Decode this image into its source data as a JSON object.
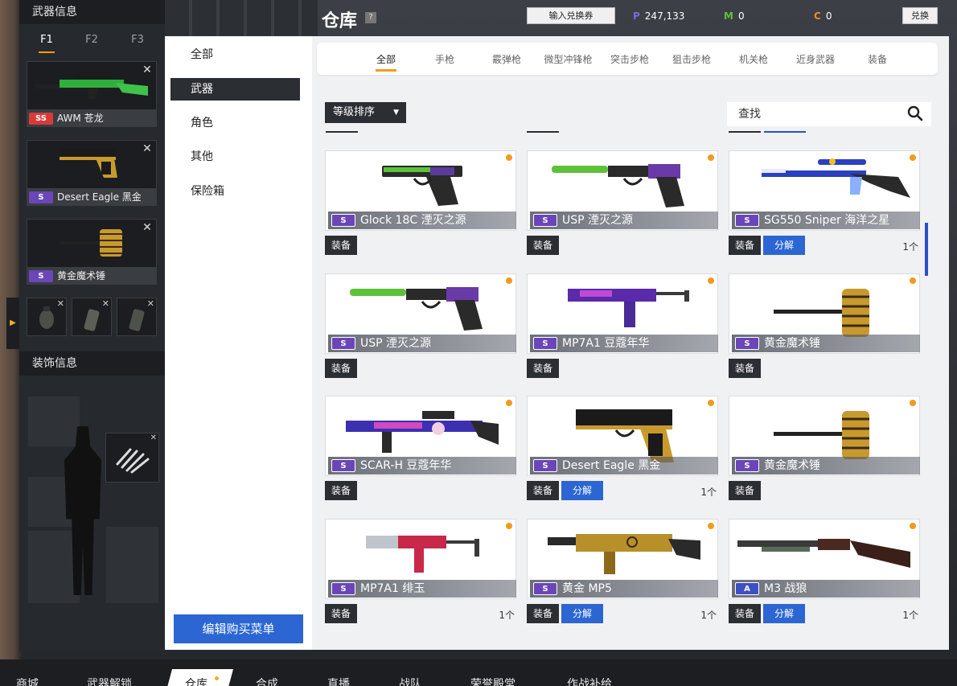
{
  "window": {
    "title": "仓库",
    "help": "?"
  },
  "header": {
    "redeem_button": "输入兑换券",
    "exchange_button": "兑换",
    "currencies": [
      {
        "letter": "P",
        "value": "247,133",
        "color": "#7a6ad8"
      },
      {
        "letter": "M",
        "value": "0",
        "color": "#5fbf3a"
      },
      {
        "letter": "C",
        "value": "0",
        "color": "#f08a24"
      }
    ]
  },
  "left_panel": {
    "weapon_info_title": "武器信息",
    "f_tabs": [
      "F1",
      "F2",
      "F3"
    ],
    "active_f_tab": "F1",
    "equipped": [
      {
        "grade": "SS",
        "name": "AWM 苍龙",
        "close": "✕"
      },
      {
        "grade": "S",
        "name": "Desert Eagle 黑金",
        "close": "✕"
      },
      {
        "grade": "S",
        "name": "黄金魔术锤",
        "close": "✕"
      }
    ],
    "grenade_close": "✕",
    "decoration_info_title": "装饰信息",
    "side_arrow": "▶"
  },
  "categories": [
    {
      "label": "全部",
      "active": false
    },
    {
      "label": "武器",
      "active": true
    },
    {
      "label": "角色",
      "active": false
    },
    {
      "label": "其他",
      "active": false
    },
    {
      "label": "保险箱",
      "active": false
    }
  ],
  "edit_menu_button": "编辑购买菜单",
  "type_tabs": [
    {
      "label": "全部",
      "active": true
    },
    {
      "label": "手枪",
      "active": false
    },
    {
      "label": "霰弹枪",
      "active": false
    },
    {
      "label": "微型冲锋枪",
      "active": false
    },
    {
      "label": "突击步枪",
      "active": false
    },
    {
      "label": "狙击步枪",
      "active": false
    },
    {
      "label": "机关枪",
      "active": false
    },
    {
      "label": "近身武器",
      "active": false
    },
    {
      "label": "装备",
      "active": false
    }
  ],
  "sort": {
    "label": "等级排序",
    "caret": "▼"
  },
  "search": {
    "placeholder": "查找"
  },
  "item_buttons": {
    "equip": "装备",
    "decompose": "分解"
  },
  "items": [
    {
      "name": "Glock 18C 湮灭之源",
      "grade": "S",
      "decomposable": false,
      "count": "",
      "gun": "pistol-green"
    },
    {
      "name": "USP 湮灭之源",
      "grade": "S",
      "decomposable": false,
      "count": "",
      "gun": "usp-green"
    },
    {
      "name": "SG550 Sniper 海洋之星",
      "grade": "S",
      "decomposable": true,
      "count": "1个",
      "gun": "sniper-blue"
    },
    {
      "name": "USP 湮灭之源",
      "grade": "S",
      "decomposable": false,
      "count": "",
      "gun": "usp-green"
    },
    {
      "name": "MP7A1 豆蔻年华",
      "grade": "S",
      "decomposable": false,
      "count": "",
      "gun": "smg-purple"
    },
    {
      "name": "黄金魔术锤",
      "grade": "S",
      "decomposable": false,
      "count": "",
      "gun": "hammer"
    },
    {
      "name": "SCAR-H 豆蔻年华",
      "grade": "S",
      "decomposable": false,
      "count": "",
      "gun": "rifle-purple"
    },
    {
      "name": "Desert Eagle 黑金",
      "grade": "S",
      "decomposable": true,
      "count": "1个",
      "gun": "deagle"
    },
    {
      "name": "黄金魔术锤",
      "grade": "S",
      "decomposable": false,
      "count": "",
      "gun": "hammer"
    },
    {
      "name": "MP7A1 绯玉",
      "grade": "S",
      "decomposable": false,
      "count": "1个",
      "gun": "smg-red"
    },
    {
      "name": "黄金 MP5",
      "grade": "S",
      "decomposable": true,
      "count": "1个",
      "gun": "mp5-gold"
    },
    {
      "name": "M3 战狼",
      "grade": "A",
      "decomposable": true,
      "count": "1个",
      "gun": "shotgun"
    }
  ],
  "bottom_nav": [
    {
      "label": "商城",
      "active": false
    },
    {
      "label": "武器解锁",
      "active": false
    },
    {
      "label": "仓库",
      "active": true
    },
    {
      "label": "合成",
      "active": false
    },
    {
      "label": "直播",
      "active": false
    },
    {
      "label": "战队",
      "active": false
    },
    {
      "label": "荣誉殿堂",
      "active": false
    },
    {
      "label": "作战补给",
      "active": false
    }
  ]
}
